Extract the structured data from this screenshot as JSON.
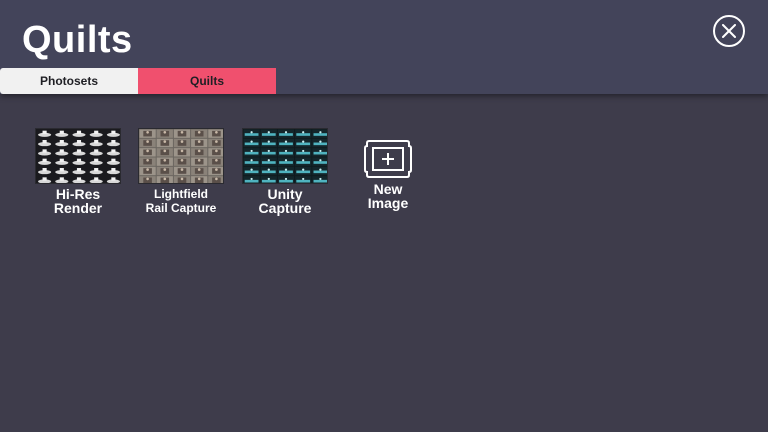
{
  "header": {
    "title": "Quilts",
    "close_icon": "close-icon"
  },
  "tabs": [
    {
      "label": "Photosets",
      "active": false
    },
    {
      "label": "Quilts",
      "active": true
    }
  ],
  "gallery": {
    "items": [
      {
        "label": "Hi-Res\nRender",
        "thumbnail": "quilt-grid-white-figures"
      },
      {
        "label": "Lightfield\nRail Capture",
        "thumbnail": "quilt-grid-photo-tiles"
      },
      {
        "label": "Unity\nCapture",
        "thumbnail": "quilt-grid-teal-scene"
      }
    ],
    "new_image": {
      "label": "New\nImage",
      "icon": "framed-plus-icon"
    }
  },
  "colors": {
    "background": "#3e3c4b",
    "header": "#43445a",
    "tab_active": "#f0506e",
    "tab_inactive": "#f1f1f1"
  }
}
